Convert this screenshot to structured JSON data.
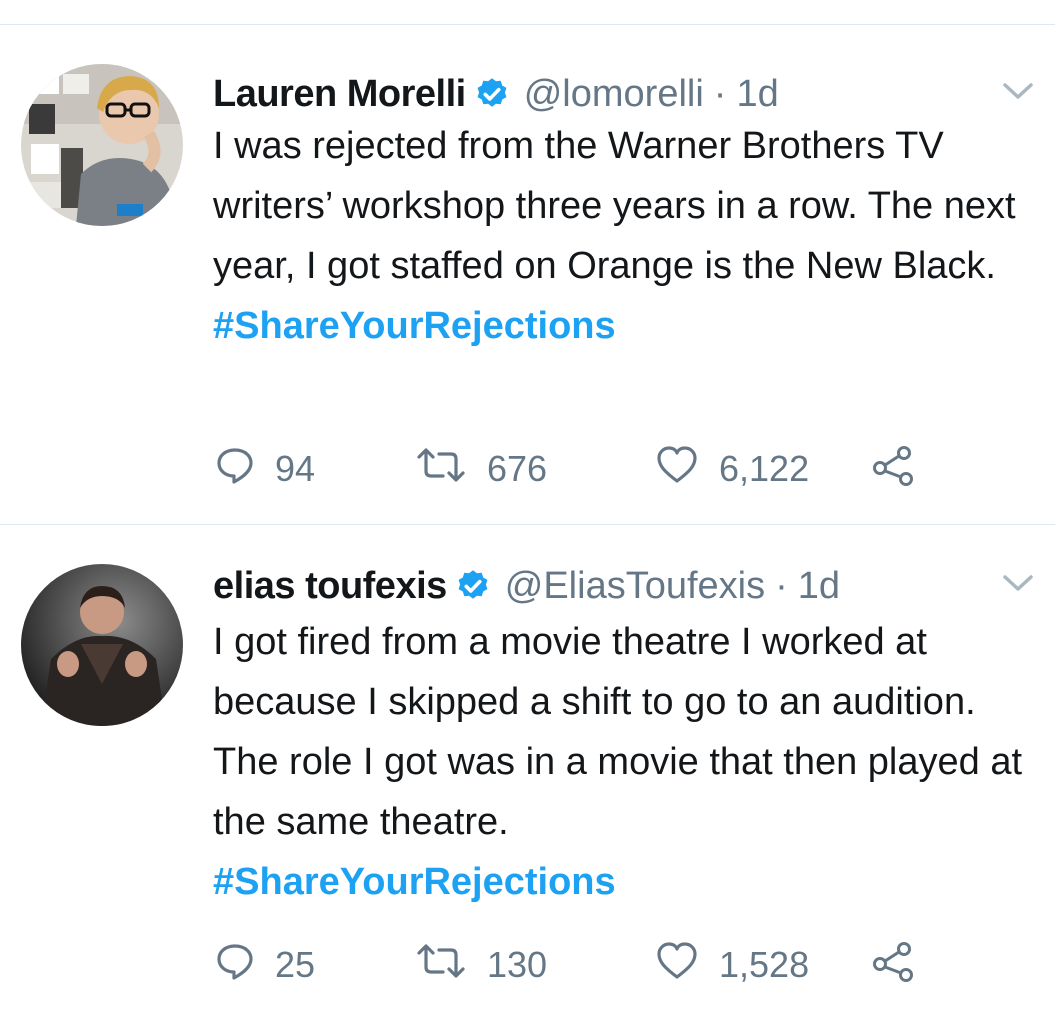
{
  "tweets": [
    {
      "name": "Lauren Morelli",
      "handle": "@lomorelli",
      "separator": "·",
      "time": "1d",
      "text": "I was rejected from the Warner Brothers TV writers’ workshop three years in a row. The next year, I got staffed on Orange is the New Black.",
      "hashtag": "#ShareYourRejections",
      "replies": "94",
      "retweets": "676",
      "likes": "6,122"
    },
    {
      "name": "elias toufexis",
      "handle": "@EliasToufexis",
      "separator": "·",
      "time": "1d",
      "text": "I got fired from a movie theatre I worked at because I skipped a shift to go to an audition. The role I got was in a movie that then played at the same theatre.",
      "hashtag": "#ShareYourRejections",
      "replies": "25",
      "retweets": "130",
      "likes": "1,528"
    }
  ],
  "colors": {
    "accent": "#1da1f2",
    "secondary_text": "#657786",
    "divider": "#e1e8ed"
  },
  "icons": [
    "verified-badge-icon",
    "chevron-down-icon",
    "reply-icon",
    "retweet-icon",
    "like-icon",
    "share-icon"
  ]
}
